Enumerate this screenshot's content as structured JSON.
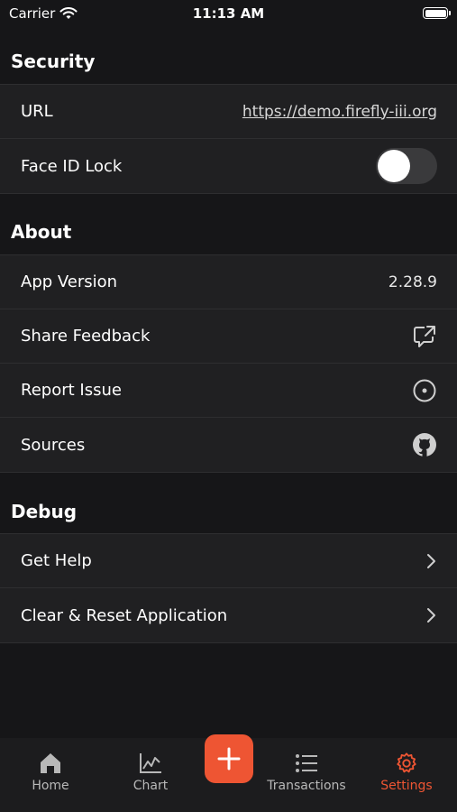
{
  "status_bar": {
    "carrier": "Carrier",
    "time": "11:13 AM"
  },
  "security": {
    "title": "Security",
    "url_label": "URL",
    "url_value": "https://demo.firefly-iii.org",
    "face_id_label": "Face ID Lock",
    "face_id_enabled": false
  },
  "about": {
    "title": "About",
    "version_label": "App Version",
    "version_value": "2.28.9",
    "feedback_label": "Share Feedback",
    "report_label": "Report Issue",
    "sources_label": "Sources"
  },
  "debug": {
    "title": "Debug",
    "help_label": "Get Help",
    "reset_label": "Clear & Reset Application"
  },
  "tab_bar": {
    "home": "Home",
    "chart": "Chart",
    "transactions": "Transactions",
    "settings": "Settings",
    "active_tab": "Settings"
  },
  "colors": {
    "accent": "#ee5533",
    "background": "#161618",
    "group": "#202022"
  }
}
